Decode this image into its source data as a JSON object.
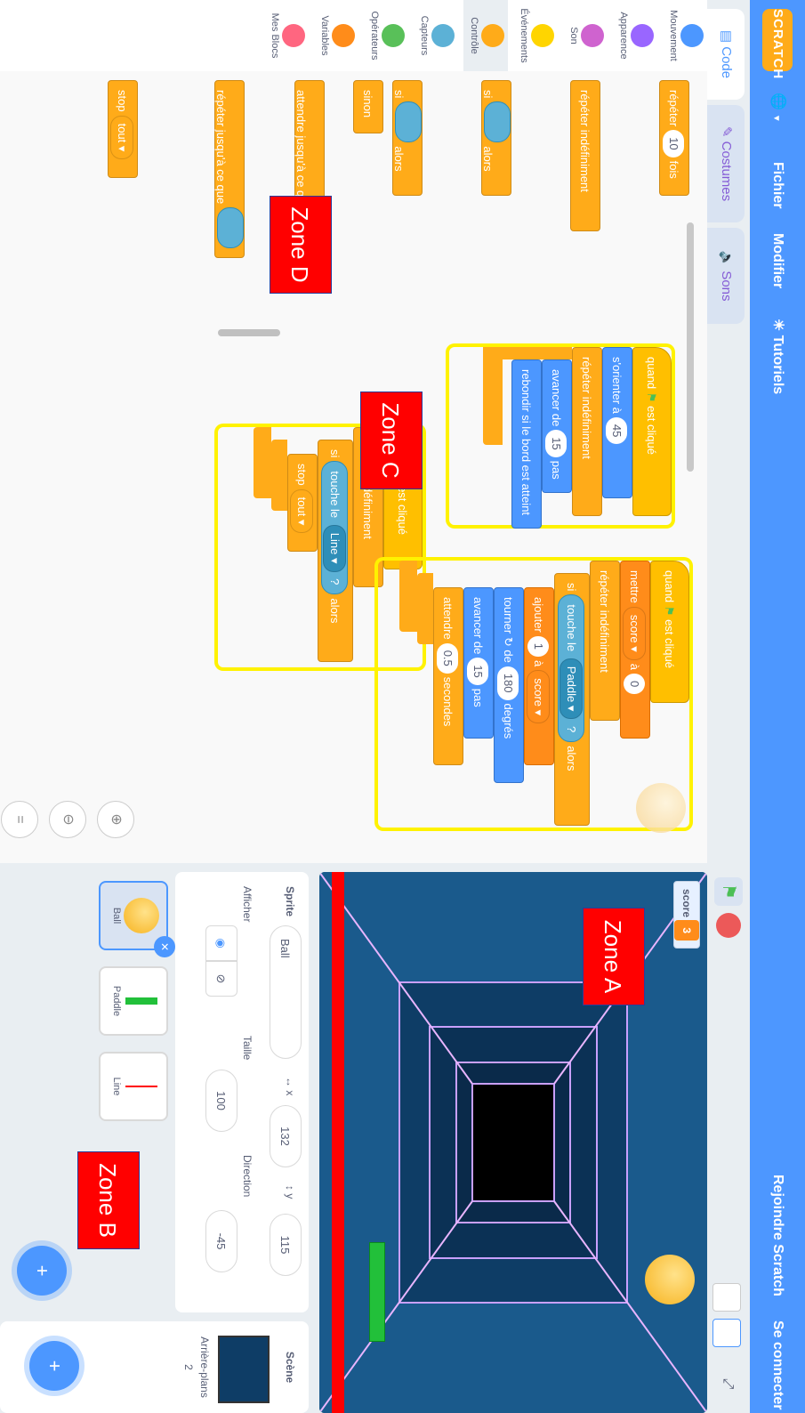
{
  "menubar": {
    "logo": "SCRATCH",
    "globe_icon": "globe-icon",
    "file": "Fichier",
    "edit": "Modifier",
    "tutorials": "Tutoriels",
    "join": "Rejoindre Scratch",
    "signin": "Se connecter"
  },
  "tabs": [
    {
      "label": "Code"
    },
    {
      "label": "Costumes"
    },
    {
      "label": "Sons"
    }
  ],
  "categories": [
    {
      "label": "Mouvement",
      "color": "#4c97ff"
    },
    {
      "label": "Apparence",
      "color": "#9966ff"
    },
    {
      "label": "Son",
      "color": "#cf63cf"
    },
    {
      "label": "Événements",
      "color": "#ffd500"
    },
    {
      "label": "Contrôle",
      "color": "#ffab19"
    },
    {
      "label": "Capteurs",
      "color": "#5cb1d6"
    },
    {
      "label": "Opérateurs",
      "color": "#59c059"
    },
    {
      "label": "Variables",
      "color": "#ff8c1a"
    },
    {
      "label": "Mes Blocs",
      "color": "#ff6680"
    }
  ],
  "palette": {
    "repeat": {
      "pre": "répéter",
      "num": "10",
      "post": "fois"
    },
    "forever": "répéter indéfiniment",
    "if": {
      "pre": "si",
      "post": "alors"
    },
    "ifelse": {
      "pre": "si",
      "post": "alors",
      "else": "sinon"
    },
    "wait_until": "attendre jusqu'à ce que",
    "repeat_until": "répéter jusqu'à ce que",
    "stop": {
      "label": "stop",
      "option": "tout"
    }
  },
  "scripts": {
    "s1": {
      "hat": "quand",
      "hat_post": "est cliqué",
      "point": "s'orienter à",
      "point_val": "45",
      "forever": "répéter indéfiniment",
      "move": "avancer de",
      "move_val": "15",
      "move_post": "pas",
      "bounce": "rebondir si le bord est atteint"
    },
    "s2": {
      "hat": "quand",
      "hat_post": "est cliqué",
      "forever": "répéter indéfiniment",
      "if": "si",
      "touch": "touche le",
      "touch_val": "Line",
      "q": "?",
      "then": "alors",
      "stop": "stop",
      "stop_val": "tout"
    },
    "s3": {
      "hat": "quand",
      "hat_post": "est cliqué",
      "set": "mettre",
      "set_var": "score",
      "set_to": "à",
      "set_val": "0",
      "forever": "répéter indéfiniment",
      "if": "si",
      "touch": "touche le",
      "touch_val": "Paddle",
      "q": "?",
      "then": "alors",
      "add": "ajouter",
      "add_val": "1",
      "add_to": "à",
      "add_var": "score",
      "turn": "tourner",
      "turn_of": "de",
      "turn_val": "180",
      "turn_post": "degrés",
      "move": "avancer de",
      "move_val": "15",
      "move_post": "pas",
      "wait": "attendre",
      "wait_val": "0.5",
      "wait_post": "secondes"
    }
  },
  "zones": {
    "a": "Zone A",
    "b": "Zone B",
    "c": "Zone C",
    "d": "Zone D"
  },
  "stage": {
    "monitor_label": "score",
    "monitor_value": "3"
  },
  "sprite_info": {
    "sprite_label": "Sprite",
    "sprite_name": "Ball",
    "x_label": "x",
    "x_val": "132",
    "y_label": "y",
    "y_val": "115",
    "show_label": "Afficher",
    "size_label": "Taille",
    "size_val": "100",
    "dir_label": "Direction",
    "dir_val": "-45"
  },
  "sprites": [
    {
      "name": "Ball"
    },
    {
      "name": "Paddle"
    },
    {
      "name": "Line"
    }
  ],
  "scene": {
    "title": "Scène",
    "backdrops_label": "Arrière-plans",
    "backdrops_count": "2"
  }
}
